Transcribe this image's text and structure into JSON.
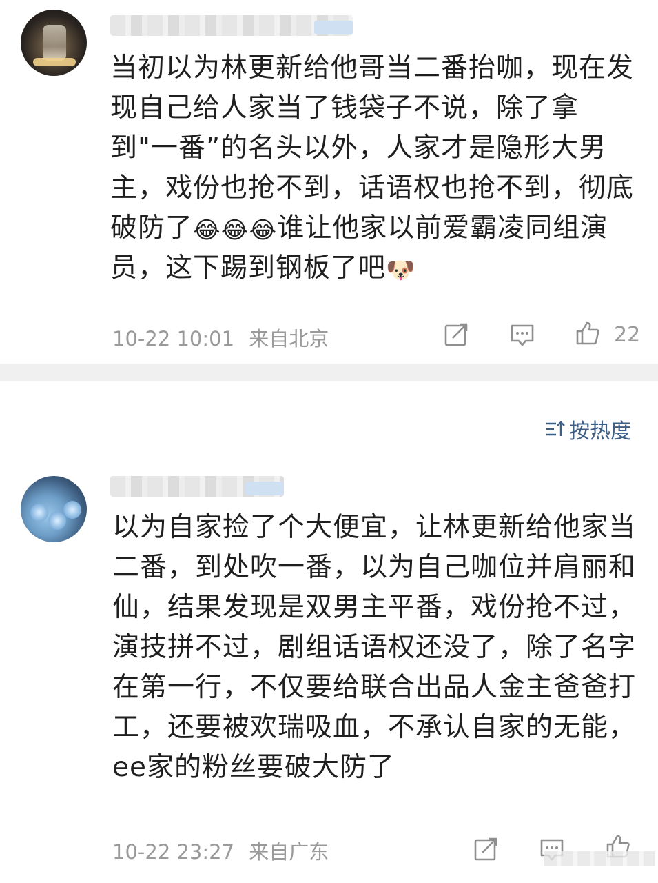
{
  "comments": [
    {
      "text_parts": [
        "当初以为林更新给他哥当二番抬咖，现在发现自己给人家当了钱袋子不说，除了拿到\"一番”的名头以外，人家才是隐形大男主，戏份也抢不到，话语权也抢不到，彻底破防了",
        "谁让他家以前爱霸凌同组演员，这下踢到钢板了吧"
      ],
      "emojis": [
        "😂",
        "😂",
        "😂"
      ],
      "end_emoji": "🐶",
      "time": "10-22 10:01",
      "location": "来自北京",
      "likes": "22"
    },
    {
      "text": "以为自家捡了个大便宜，让林更新给他家当二番，到处吹一番，以为自己咖位并肩丽和仙，结果发现是双男主平番，戏份抢不过，演技拼不过，剧组话语权还没了，除了名字在第一行，不仅要给联合出品人金主爸爸打工，还要被欢瑞吸血，不承认自家的无能，ee家的粉丝要破大防了",
      "time": "10-22 23:27",
      "location": "来自广东"
    }
  ],
  "sort": {
    "label": "按热度"
  },
  "icons": {
    "share": "share-icon",
    "comment": "comment-icon",
    "like": "thumbs-up-icon",
    "sort": "sort-icon"
  },
  "colors": {
    "sort_accent": "#3d5f86",
    "meta": "#9a9a9a",
    "divider": "#f0f0f0"
  }
}
